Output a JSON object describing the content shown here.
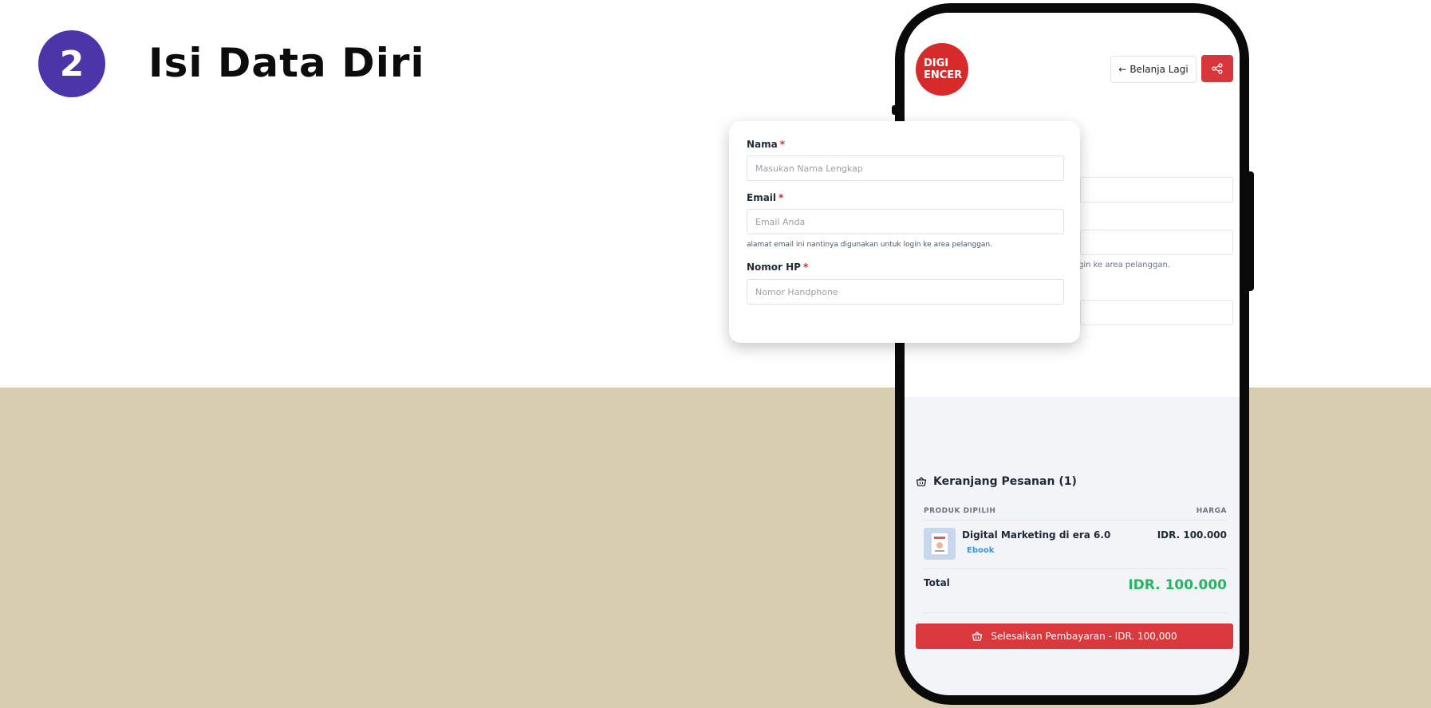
{
  "step": {
    "number": "2",
    "title": "Isi Data Diri"
  },
  "header": {
    "logo_line1": "DIGI",
    "logo_line2": "ENCER",
    "back_arrow": "←",
    "back_label": "Belanja Lagi"
  },
  "form": {
    "name_label": "Nama",
    "name_placeholder": "Masukan Nama Lengkap",
    "email_label": "Email",
    "email_placeholder": "Email Anda",
    "email_help": "alamat email ini nantinya digunakan untuk login ke area pelanggan.",
    "email_help_clipped": "gin ke area pelanggan.",
    "phone_label": "Nomor HP",
    "phone_placeholder": "Nomor Handphone",
    "required_mark": "*"
  },
  "cart": {
    "title": "Keranjang Pesanan (1)",
    "col_product": "PRODUK DIPILIH",
    "col_price": "HARGA",
    "items": [
      {
        "name": "Digital Marketing di era 6.0",
        "type": "Ebook",
        "price": "IDR. 100.000"
      }
    ],
    "total_label": "Total",
    "total_value": "IDR. 100.000",
    "pay_button": "Selesaikan Pembayaran - IDR. 100,000"
  },
  "colors": {
    "step_circle": "#4c35a8",
    "bottom_bg": "#d8cdaf",
    "brand_red": "#d72a2a",
    "pay_button": "#d9393d",
    "total_green": "#28b463",
    "ebook_blue": "#3b94d6"
  },
  "icons": [
    "arrow-left-icon",
    "share-icon",
    "basket-icon",
    "book-thumbnail"
  ]
}
